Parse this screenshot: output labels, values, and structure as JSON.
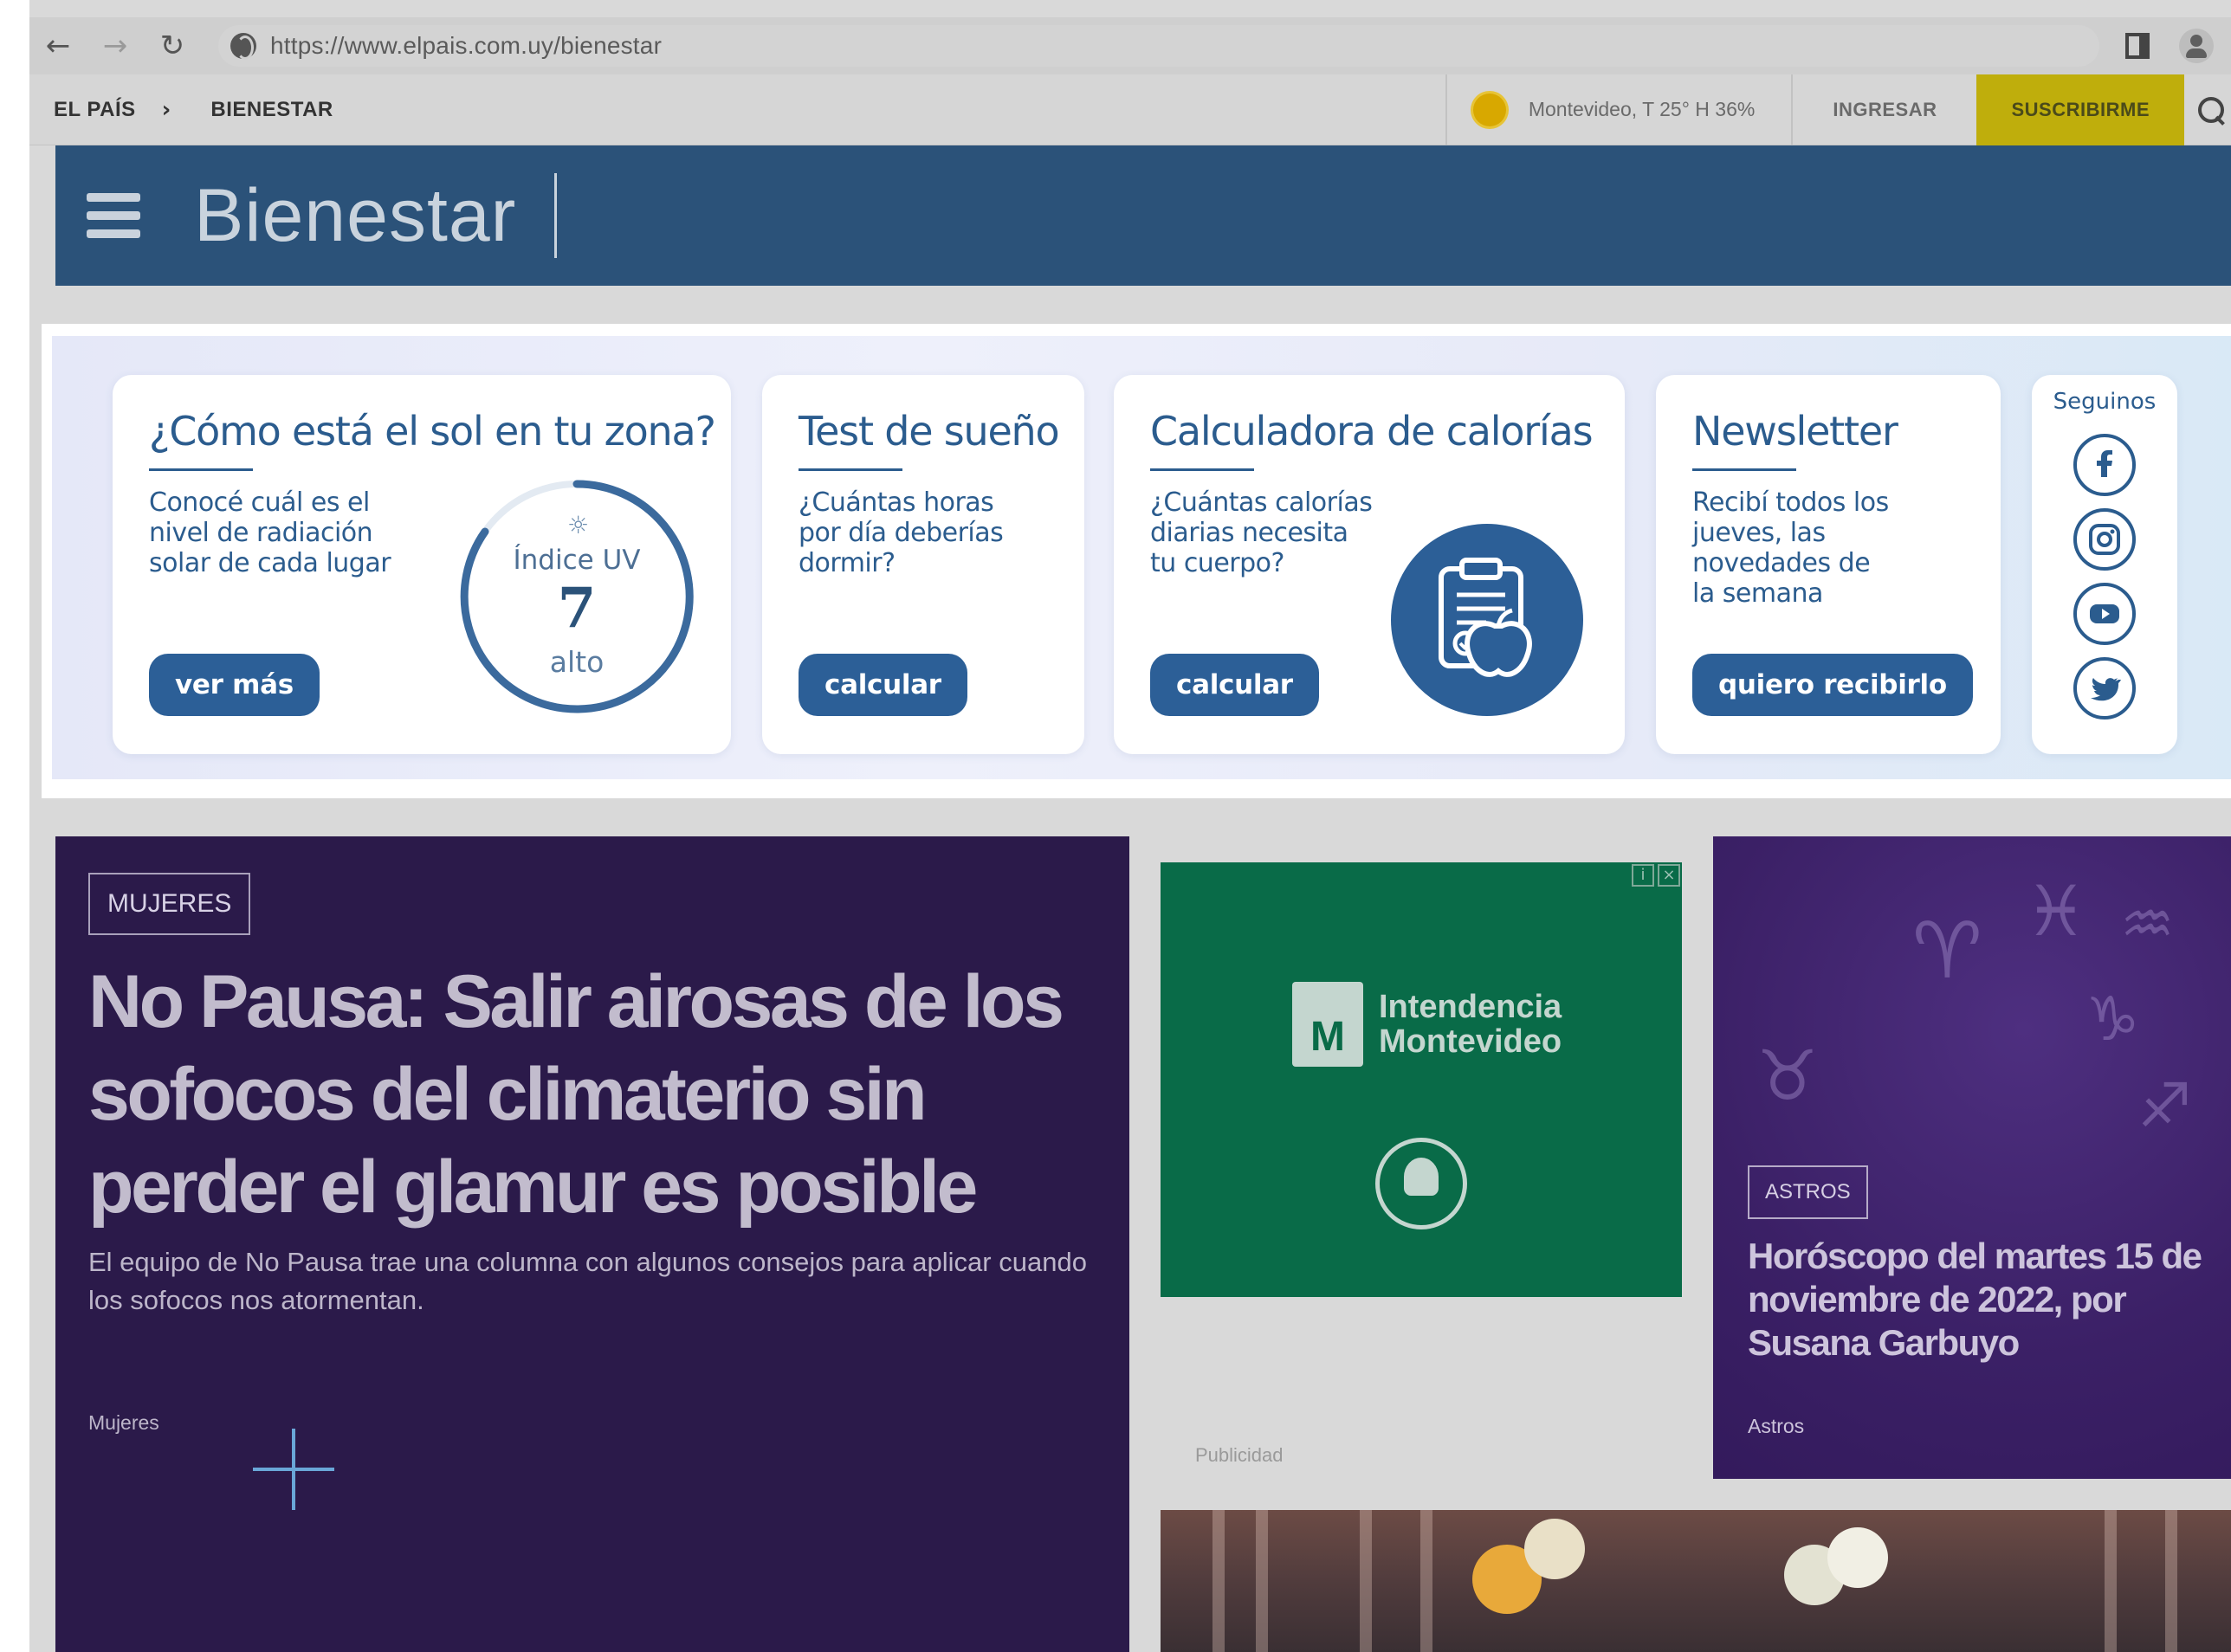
{
  "browser": {
    "back_icon": "arrow-left-icon",
    "forward_icon": "arrow-right-icon",
    "reload_icon": "reload-icon",
    "url": "https://www.elpais.com.uy/bienestar"
  },
  "site_bar": {
    "breadcrumb_home": "EL PAÍS",
    "breadcrumb_current": "BIENESTAR",
    "weather": "Montevideo, T 25° H 36%",
    "login": "INGRESAR",
    "subscribe": "SUSCRIBIRME"
  },
  "section": {
    "title": "Bienestar"
  },
  "tools": {
    "sun": {
      "title": "¿Cómo está el sol en tu zona?",
      "text": "Conocé cuál es el\nnivel de radiación\nsolar de cada lugar",
      "button": "ver más",
      "uv_label": "Índice UV",
      "uv_value": "7",
      "uv_level": "alto"
    },
    "sleep": {
      "title": "Test de sueño",
      "text": "¿Cuántas horas\npor día deberías\ndormir?",
      "button": "calcular"
    },
    "calories": {
      "title": "Calculadora de calorías",
      "text": "¿Cuántas calorías\ndiarias necesita\ntu cuerpo?",
      "button": "calcular"
    },
    "newsletter": {
      "title": "Newsletter",
      "text": "Recibí todos los\njueves, las\nnovedades de\nla semana",
      "button": "quiero recibirlo"
    },
    "social": {
      "title": "Seguinos",
      "icons": [
        "facebook-icon",
        "instagram-icon",
        "youtube-icon",
        "twitter-icon"
      ]
    }
  },
  "feature": {
    "tag": "MUJERES",
    "headline": "No Pausa: Salir airosas de los sofocos del climaterio sin perder el glamur es posible",
    "summary": "El equipo de No Pausa trae una columna con algunos consejos para aplicar cuando los sofocos nos atormentan.",
    "category": "Mujeres"
  },
  "ad": {
    "brand": "Intendencia\nMontevideo",
    "label": "Publicidad"
  },
  "astros": {
    "tag": "ASTROS",
    "headline": "Horóscopo del martes 15 de noviembre de 2022, por Susana Garbuyo",
    "category": "Astros"
  },
  "colors": {
    "header_blue": "#2b5279",
    "accent_blue": "#2c5f97",
    "subscribe_yellow": "#bfae0c",
    "feature_purple": "#2b1a4a",
    "ad_green": "#096b48"
  }
}
